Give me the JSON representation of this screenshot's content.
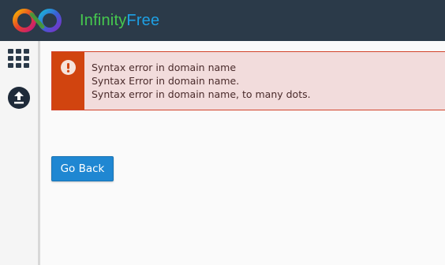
{
  "header": {
    "brand_part1": "Infinity",
    "brand_part2": "Free"
  },
  "sidebar": {
    "items": [
      {
        "icon": "grid-icon"
      },
      {
        "icon": "upload-icon"
      }
    ]
  },
  "alert": {
    "icon": "exclamation-icon",
    "messages": [
      "Syntax error in domain name",
      "Syntax Error in domain name.",
      "Syntax error in domain name, to many dots."
    ]
  },
  "actions": {
    "go_back_label": "Go Back"
  },
  "colors": {
    "header_bg": "#2b3a49",
    "brand_green": "#46c94e",
    "brand_blue": "#1ea0e4",
    "alert_accent": "#d1440f",
    "alert_bg": "#f2dcdc",
    "button_bg": "#1f87d2"
  }
}
